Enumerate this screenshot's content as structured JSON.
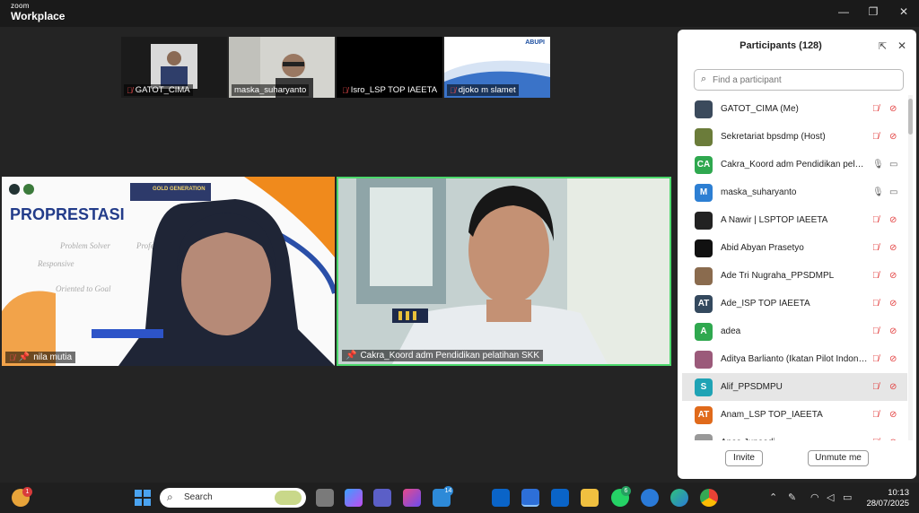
{
  "app": {
    "brand_small": "zoom",
    "brand_large": "Workplace"
  },
  "window": {
    "minimize": "—",
    "restore": "❐",
    "close": "✕"
  },
  "thumbnails": [
    {
      "name": "GATOT_CIMA",
      "muted": true
    },
    {
      "name": "maska_suharyanto",
      "muted": false
    },
    {
      "name": "Isro_LSP TOP IAEETA",
      "muted": true
    },
    {
      "name": "djoko m slamet",
      "muted": true
    }
  ],
  "thumb_logo_text": "ABUPI",
  "tiles": {
    "left": {
      "name": "nila mutia",
      "slide_title": "PROPRESTASI",
      "banner": "GOLD GENERATION"
    },
    "right": {
      "name": "Cakra_Koord adm Pendidikan pelatihan SKK"
    }
  },
  "panel": {
    "title": "Participants (128)",
    "search_placeholder": "Find a participant",
    "invite_label": "Invite",
    "unmute_label": "Unmute me",
    "participants": [
      {
        "name": "GATOT_CIMA (Me)",
        "initials": "",
        "color": "#3b4a5c",
        "mic": "muted",
        "cam": "off"
      },
      {
        "name": "Sekretariat bpsdmp (Host)",
        "initials": "",
        "color": "#6b7c3a",
        "mic": "muted",
        "cam": "off"
      },
      {
        "name": "Cakra_Koord adm Pendidikan pelati...",
        "initials": "CA",
        "color": "#2fa84f",
        "mic": "on",
        "cam": "on"
      },
      {
        "name": "maska_suharyanto",
        "initials": "M",
        "color": "#2d7fd3",
        "mic": "on",
        "cam": "on"
      },
      {
        "name": "A Nawir | LSPTOP IAEETA",
        "initials": "",
        "color": "#222222",
        "mic": "muted",
        "cam": "off"
      },
      {
        "name": "Abid Abyan Prasetyo",
        "initials": "",
        "color": "#111111",
        "mic": "muted",
        "cam": "off"
      },
      {
        "name": "Ade Tri Nugraha_PPSDMPL",
        "initials": "",
        "color": "#8a6b4e",
        "mic": "muted",
        "cam": "off"
      },
      {
        "name": "Ade_ISP TOP IAEETA",
        "initials": "AT",
        "color": "#34495e",
        "mic": "muted",
        "cam": "off"
      },
      {
        "name": "adea",
        "initials": "A",
        "color": "#2fa84f",
        "mic": "muted",
        "cam": "off"
      },
      {
        "name": "Aditya Barlianto (Ikatan Pilot Indone...",
        "initials": "",
        "color": "#9b5a7a",
        "mic": "muted",
        "cam": "off"
      },
      {
        "name": "Alif_PPSDMPU",
        "initials": "S",
        "color": "#1fa3b5",
        "mic": "muted",
        "cam": "off"
      },
      {
        "name": "Anam_LSP TOP_IAEETA",
        "initials": "AT",
        "color": "#e06a1b",
        "mic": "muted",
        "cam": "off"
      },
      {
        "name": "Anas Junaedi",
        "initials": "",
        "color": "#999999",
        "mic": "muted",
        "cam": "off"
      }
    ]
  },
  "taskbar": {
    "search_label": "Search",
    "time": "10:13",
    "date": "28/07/2025",
    "notif_count": "1",
    "badge_14": "14",
    "badge_6": "6"
  }
}
